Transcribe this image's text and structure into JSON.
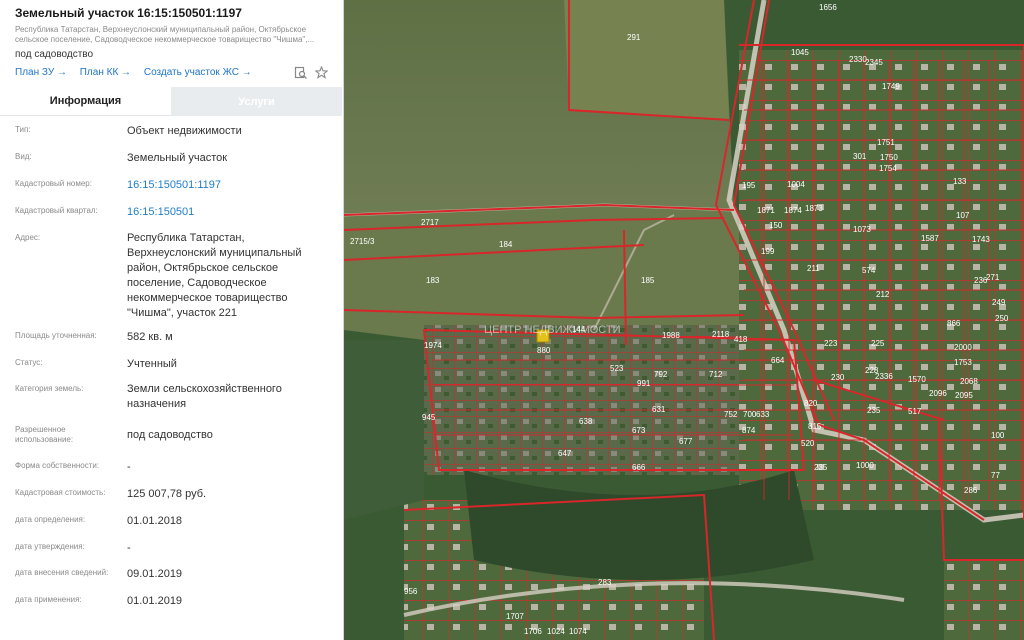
{
  "header": {
    "title": "Земельный участок 16:15:150501:1197",
    "subtitle": "Республика Татарстан, Верхнеуслонский муниципальный район, Октябрьское сельское поселение, Садоводческое некоммерческое товарищество \"Чишма\",...",
    "purpose": "под садоводство",
    "links": [
      "План ЗУ →",
      "План КК →",
      "Создать участок ЖС →"
    ],
    "icons": [
      "search-doc-icon",
      "star-icon"
    ]
  },
  "tabs": [
    "Информация",
    "Услуги"
  ],
  "info": [
    {
      "label": "Тип:",
      "value": "Объект недвижимости"
    },
    {
      "label": "Вид:",
      "value": "Земельный участок"
    },
    {
      "label": "Кадастровый номер:",
      "value": "16:15:150501:1197"
    },
    {
      "label": "Кадастровый квартал:",
      "value": "16:15:150501"
    },
    {
      "label": "Адрес:",
      "value": "Республика Татарстан, Верхнеуслонский муниципальный район, Октябрьское сельское поселение, Садоводческое некоммерческое товарищество \"Чишма\", участок 221"
    },
    {
      "label": "Площадь уточненная:",
      "value": "582 кв. м"
    },
    {
      "label": "Статус:",
      "value": "Учтенный"
    },
    {
      "label": "Категория земель:",
      "value": "Земли сельскохозяйственного назначения"
    },
    {
      "label": "Разрешенное использование:",
      "value": "под садоводство"
    },
    {
      "label": "Форма собственности:",
      "value": "-"
    },
    {
      "label": "Кадастровая стоимость:",
      "value": "125 007,78 руб."
    },
    {
      "label": "дата определения:",
      "value": "01.01.2018"
    },
    {
      "label": "дата утверждения:",
      "value": "-"
    },
    {
      "label": "дата внесения сведений:",
      "value": "09.01.2019"
    },
    {
      "label": "дата применения:",
      "value": "01.01.2019"
    }
  ],
  "map": {
    "watermark": "ЦЕНТР НЕДВИЖИМОСТИ",
    "labels": [
      "291",
      "1045",
      "1656",
      "2717",
      "2715/3",
      "184",
      "183",
      "185",
      "144",
      "880",
      "1974",
      "945",
      "523",
      "991",
      "792",
      "712",
      "631",
      "673",
      "677",
      "638",
      "647",
      "666",
      "752",
      "700",
      "633",
      "874",
      "820",
      "815",
      "520",
      "235",
      "664",
      "1988",
      "2118",
      "418",
      "1004",
      "1871",
      "1874",
      "1873",
      "195",
      "150",
      "199",
      "211",
      "574",
      "212",
      "225",
      "223",
      "230",
      "228",
      "235",
      "517",
      "1570",
      "2096",
      "2095",
      "2000",
      "2068",
      "1753",
      "866",
      "250",
      "249",
      "236",
      "271",
      "100",
      "77",
      "286",
      "1000",
      "283",
      "956",
      "1707",
      "1706",
      "1024",
      "1074",
      "1073",
      "1587",
      "1743",
      "133",
      "107",
      "301",
      "1750",
      "1754",
      "1751",
      "1749",
      "2330",
      "2345",
      "2336"
    ],
    "colors": {
      "lines": "#d8262b",
      "plot": "#e3c21b"
    }
  }
}
